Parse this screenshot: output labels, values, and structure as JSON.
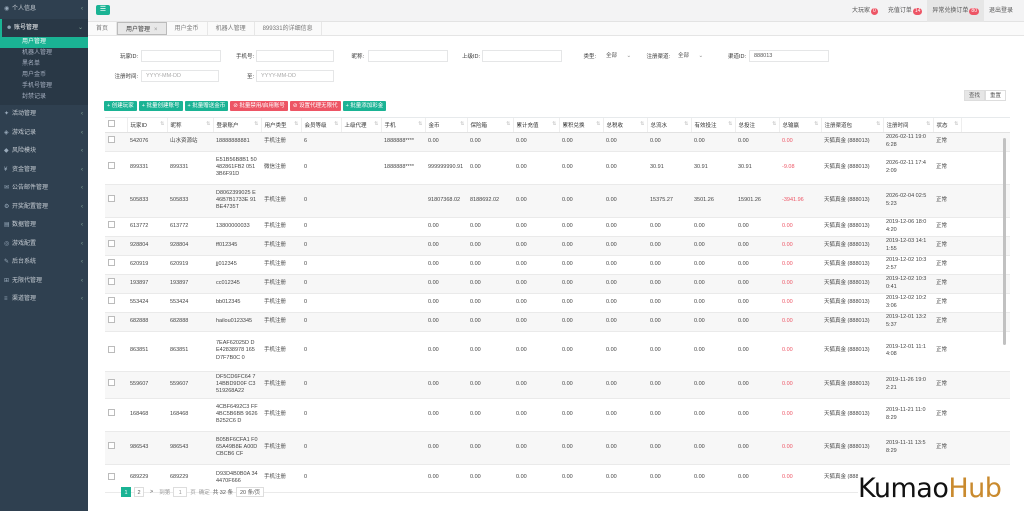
{
  "sidebar": {
    "items": [
      {
        "label": "个人信息",
        "icon": "user-icon",
        "open": false
      },
      {
        "label": "账号管理",
        "icon": "users-icon",
        "open": true,
        "children": [
          {
            "label": "用户管理",
            "active": true
          },
          {
            "label": "机器人管理",
            "active": false
          },
          {
            "label": "黑名单",
            "active": false
          },
          {
            "label": "用户金币",
            "active": false
          },
          {
            "label": "手机号管理",
            "active": false
          },
          {
            "label": "封禁记录",
            "active": false
          }
        ]
      },
      {
        "label": "活动管理",
        "icon": "gift-icon",
        "open": false
      },
      {
        "label": "游戏记录",
        "icon": "gamepad-icon",
        "open": false
      },
      {
        "label": "风险模块",
        "icon": "shield-icon",
        "open": false
      },
      {
        "label": "资金管理",
        "icon": "money-icon",
        "open": false
      },
      {
        "label": "公告邮件管理",
        "icon": "mail-icon",
        "open": false
      },
      {
        "label": "开奖配置管理",
        "icon": "settings-icon",
        "open": false
      },
      {
        "label": "数据管理",
        "icon": "chart-icon",
        "open": false
      },
      {
        "label": "游戏配置",
        "icon": "game-config-icon",
        "open": false
      },
      {
        "label": "后台系统",
        "icon": "wrench-icon",
        "open": false
      },
      {
        "label": "无限代管理",
        "icon": "sitemap-icon",
        "open": false
      },
      {
        "label": "渠道管理",
        "icon": "channel-icon",
        "open": false
      }
    ]
  },
  "topbar": {
    "links": [
      {
        "label": "大玩家",
        "badge": "0"
      },
      {
        "label": "充值订单",
        "badge": "14"
      },
      {
        "label": "异常兑换订单",
        "badge": "80",
        "hl": true
      },
      {
        "label": "退出登录",
        "badge": ""
      }
    ]
  },
  "tabs": [
    {
      "label": "首页",
      "active": false
    },
    {
      "label": "用户管理",
      "active": true,
      "close": "×"
    },
    {
      "label": "用户金币",
      "active": false
    },
    {
      "label": "机器人管理",
      "active": false
    },
    {
      "label": "899331的详细信息",
      "active": false
    }
  ],
  "filters": {
    "row1": [
      {
        "label": "玩家ID:",
        "value": "",
        "placeholder": ""
      },
      {
        "label": "手机号:",
        "value": "",
        "placeholder": ""
      },
      {
        "label": "昵称:",
        "value": "",
        "placeholder": ""
      },
      {
        "label": "上级ID:",
        "value": "",
        "placeholder": ""
      },
      {
        "label": "类型:",
        "select": "全部"
      },
      {
        "label": "注册渠道:",
        "select": "全部"
      },
      {
        "label": "渠道ID:",
        "value": "888013",
        "placeholder": ""
      }
    ],
    "row2": [
      {
        "label": "注册时间:",
        "placeholder": "YYYY-MM-DD"
      },
      {
        "label": "至:",
        "placeholder": "YYYY-MM-DD"
      }
    ]
  },
  "query_buttons": {
    "search": "查找",
    "reset": "重置"
  },
  "action_buttons": [
    {
      "label": "+ 创建玩家",
      "color": "teal"
    },
    {
      "label": "+ 批量创建账号",
      "color": "teal"
    },
    {
      "label": "+ 批量赠送金币",
      "color": "teal"
    },
    {
      "label": "⊘ 批量禁用/启用账号",
      "color": "red"
    },
    {
      "label": "⊘ 设置代理无限代",
      "color": "red"
    },
    {
      "label": "+ 批量添加彩金",
      "color": "teal"
    }
  ],
  "table": {
    "columns": [
      "玩家ID",
      "昵称",
      "登录账户",
      "用户类型",
      "会员等级",
      "上级代理",
      "手机",
      "金币",
      "保险箱",
      "累计充值",
      "累积兑换",
      "总税收",
      "总流水",
      "有效投注",
      "总投注",
      "总输赢",
      "注册渠道包",
      "注册时间",
      "状态"
    ],
    "rows": [
      {
        "id": "542076",
        "nick": "山水资源站",
        "acct": "18888888881",
        "type": "手机注册",
        "lvl": "6",
        "agent": "",
        "phone": "1888888****",
        "gold": "0.00",
        "safe": "0.00",
        "rech": "0.00",
        "exch": "0.00",
        "tax": "0.00",
        "flow": "0.00",
        "valid": "0.00",
        "bet": "0.00",
        "win": "0.00",
        "chan": "天狐真金 (888013)",
        "time": "2026-02-11 19:06:28",
        "status": "正常"
      },
      {
        "id": "899331",
        "nick": "899331",
        "acct": "E51B56B8B1 50482861FB2 0513B6F91D",
        "type": "微信注册",
        "lvl": "0",
        "agent": "",
        "phone": "1888888****",
        "gold": "999999990.91",
        "safe": "0.00",
        "rech": "0.00",
        "exch": "0.00",
        "tax": "0.00",
        "flow": "30.91",
        "valid": "30.91",
        "bet": "30.91",
        "win": "-9.08",
        "chan": "天狐真金 (888013)",
        "time": "2026-02-11 17:42:09",
        "status": "正常"
      },
      {
        "id": "505833",
        "nick": "505833",
        "acct": "D8062399025 E46B7B1733E 91BE4735T",
        "type": "手机注册",
        "lvl": "0",
        "agent": "",
        "phone": "",
        "gold": "91807368.02",
        "safe": "8188692.02",
        "rech": "0.00",
        "exch": "0.00",
        "tax": "0.00",
        "flow": "15375.27",
        "valid": "3501.26",
        "bet": "15901.26",
        "win": "-3941.96",
        "chan": "天狐真金 (888013)",
        "time": "2026-02-04 02:55:23",
        "status": "正常"
      },
      {
        "id": "613772",
        "nick": "613772",
        "acct": "13800000033",
        "type": "手机注册",
        "lvl": "0",
        "agent": "",
        "phone": "",
        "gold": "0.00",
        "safe": "0.00",
        "rech": "0.00",
        "exch": "0.00",
        "tax": "0.00",
        "flow": "0.00",
        "valid": "0.00",
        "bet": "0.00",
        "win": "0.00",
        "chan": "天狐真金 (888013)",
        "time": "2019-12-06 18:04:20",
        "status": "正常"
      },
      {
        "id": "928804",
        "nick": "928804",
        "acct": "ff012345",
        "type": "手机注册",
        "lvl": "0",
        "agent": "",
        "phone": "",
        "gold": "0.00",
        "safe": "0.00",
        "rech": "0.00",
        "exch": "0.00",
        "tax": "0.00",
        "flow": "0.00",
        "valid": "0.00",
        "bet": "0.00",
        "win": "0.00",
        "chan": "天狐真金 (888013)",
        "time": "2019-12-03 14:11:55",
        "status": "正常"
      },
      {
        "id": "620919",
        "nick": "620919",
        "acct": "jj012345",
        "type": "手机注册",
        "lvl": "0",
        "agent": "",
        "phone": "",
        "gold": "0.00",
        "safe": "0.00",
        "rech": "0.00",
        "exch": "0.00",
        "tax": "0.00",
        "flow": "0.00",
        "valid": "0.00",
        "bet": "0.00",
        "win": "0.00",
        "chan": "天狐真金 (888013)",
        "time": "2019-12-02 10:32:57",
        "status": "正常"
      },
      {
        "id": "193897",
        "nick": "193897",
        "acct": "cc012345",
        "type": "手机注册",
        "lvl": "0",
        "agent": "",
        "phone": "",
        "gold": "0.00",
        "safe": "0.00",
        "rech": "0.00",
        "exch": "0.00",
        "tax": "0.00",
        "flow": "0.00",
        "valid": "0.00",
        "bet": "0.00",
        "win": "0.00",
        "chan": "天狐真金 (888013)",
        "time": "2019-12-02 10:30:41",
        "status": "正常"
      },
      {
        "id": "553424",
        "nick": "553424",
        "acct": "bb012345",
        "type": "手机注册",
        "lvl": "0",
        "agent": "",
        "phone": "",
        "gold": "0.00",
        "safe": "0.00",
        "rech": "0.00",
        "exch": "0.00",
        "tax": "0.00",
        "flow": "0.00",
        "valid": "0.00",
        "bet": "0.00",
        "win": "0.00",
        "chan": "天狐真金 (888013)",
        "time": "2019-12-02 10:23:06",
        "status": "正常"
      },
      {
        "id": "682888",
        "nick": "682888",
        "acct": "hailou0123345",
        "type": "手机注册",
        "lvl": "0",
        "agent": "",
        "phone": "",
        "gold": "0.00",
        "safe": "0.00",
        "rech": "0.00",
        "exch": "0.00",
        "tax": "0.00",
        "flow": "0.00",
        "valid": "0.00",
        "bet": "0.00",
        "win": "0.00",
        "chan": "天狐真金 (888013)",
        "time": "2019-12-01 13:25:37",
        "status": "正常"
      },
      {
        "id": "863851",
        "nick": "863851",
        "acct": "7EAF62025D DE42838978 165D7F7B0C 0",
        "type": "手机注册",
        "lvl": "0",
        "agent": "",
        "phone": "",
        "gold": "0.00",
        "safe": "0.00",
        "rech": "0.00",
        "exch": "0.00",
        "tax": "0.00",
        "flow": "0.00",
        "valid": "0.00",
        "bet": "0.00",
        "win": "0.00",
        "chan": "天狐真金 (888013)",
        "time": "2019-12-01 11:14:08",
        "status": "正常"
      },
      {
        "id": "559607",
        "nick": "559607",
        "acct": "DF5CD6FC64 714BBD9D0F C3519268A22",
        "type": "手机注册",
        "lvl": "0",
        "agent": "",
        "phone": "",
        "gold": "0.00",
        "safe": "0.00",
        "rech": "0.00",
        "exch": "0.00",
        "tax": "0.00",
        "flow": "0.00",
        "valid": "0.00",
        "bet": "0.00",
        "win": "0.00",
        "chan": "天狐真金 (888013)",
        "time": "2019-11-26 19:02:21",
        "status": "正常"
      },
      {
        "id": "168468",
        "nick": "168468",
        "acct": "4CBF6492C3 FF4BC5B6BB 9626B252C6 D",
        "type": "手机注册",
        "lvl": "0",
        "agent": "",
        "phone": "",
        "gold": "0.00",
        "safe": "0.00",
        "rech": "0.00",
        "exch": "0.00",
        "tax": "0.00",
        "flow": "0.00",
        "valid": "0.00",
        "bet": "0.00",
        "win": "0.00",
        "chan": "天狐真金 (888013)",
        "time": "2019-11-21 11:08:29",
        "status": "正常"
      },
      {
        "id": "986543",
        "nick": "986543",
        "acct": "B05BF6CFA1 F065A49B8E A00DCBCB6 CF",
        "type": "手机注册",
        "lvl": "0",
        "agent": "",
        "phone": "",
        "gold": "0.00",
        "safe": "0.00",
        "rech": "0.00",
        "exch": "0.00",
        "tax": "0.00",
        "flow": "0.00",
        "valid": "0.00",
        "bet": "0.00",
        "win": "0.00",
        "chan": "天狐真金 (888013)",
        "time": "2019-11-11 13:58:29",
        "status": "正常"
      },
      {
        "id": "689229",
        "nick": "689229",
        "acct": "D93D4B0B0A 344470F666",
        "type": "手机注册",
        "lvl": "0",
        "agent": "",
        "phone": "",
        "gold": "0.00",
        "safe": "0.00",
        "rech": "0.00",
        "exch": "0.00",
        "tax": "0.00",
        "flow": "0.00",
        "valid": "0.00",
        "bet": "0.00",
        "win": "0.00",
        "chan": "天狐真金 (888013)",
        "time": "",
        "status": "正常"
      }
    ]
  },
  "pager": {
    "pages": [
      "1",
      "2"
    ],
    "next": ">",
    "end_label": "到第",
    "page_input": "1",
    "unit": "页",
    "go": "确定",
    "total": "共 32 条",
    "per_page": "20 条/页"
  },
  "watermark": {
    "part1": "Kumao",
    "part2": "Hub"
  },
  "colors": {
    "accent": "#1ab394",
    "danger": "#ed5565",
    "sidebar": "#2f4050"
  }
}
